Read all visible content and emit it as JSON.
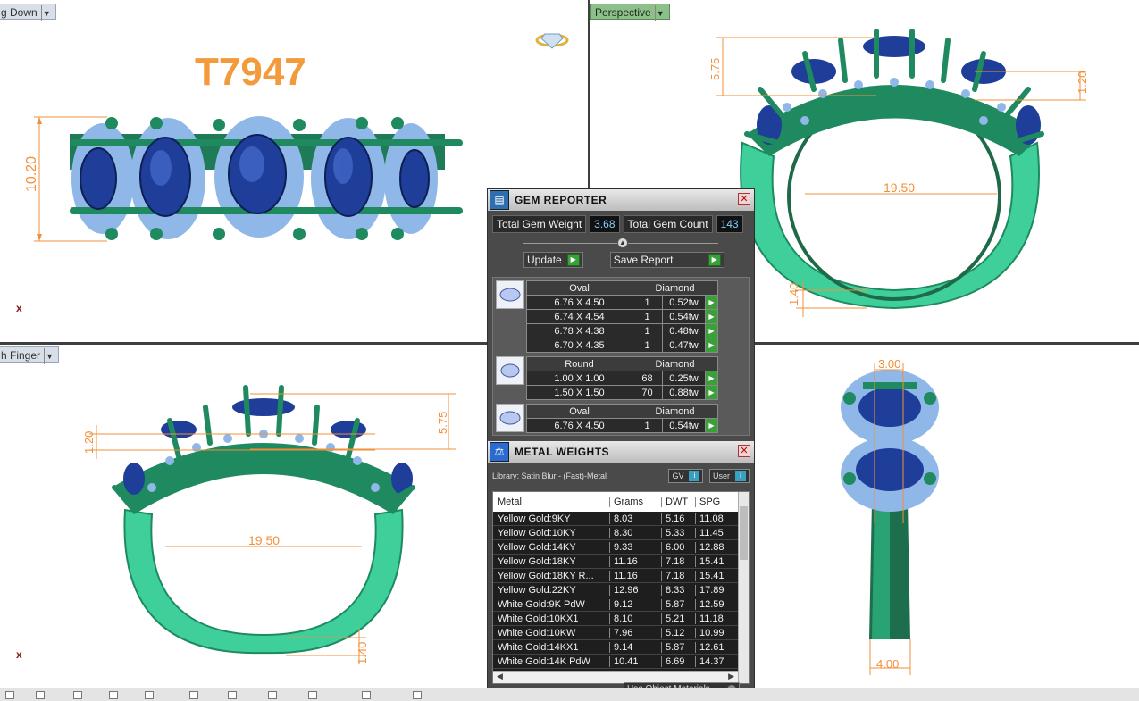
{
  "viewports": {
    "top_left": {
      "tab": "g Down",
      "title_code": "T7947",
      "dims": {
        "height": "10.20"
      }
    },
    "top_right": {
      "tab": "Perspective",
      "dims": {
        "top": "5.75",
        "right": "1.20",
        "width": "19.50",
        "bottom": "1.40"
      }
    },
    "bottom_left": {
      "tab": "h Finger",
      "dims": {
        "left": "1.20",
        "right": "5.75",
        "width": "19.50",
        "bottom": "1.40"
      }
    },
    "bottom_right": {
      "dims": {
        "top": "3.00",
        "bottom": "4.00"
      }
    }
  },
  "gem_reporter": {
    "title": "GEM REPORTER",
    "total_weight_label": "Total Gem Weight",
    "total_weight_value": "3.68",
    "total_count_label": "Total Gem Count",
    "total_count_value": "143",
    "update_label": "Update",
    "save_label": "Save Report",
    "groups": [
      {
        "shape": "Oval",
        "material": "Diamond",
        "rows": [
          {
            "size": "6.76 X 4.50",
            "qty": "1",
            "weight": "0.52tw"
          },
          {
            "size": "6.74 X 4.54",
            "qty": "1",
            "weight": "0.54tw"
          },
          {
            "size": "6.78 X 4.38",
            "qty": "1",
            "weight": "0.48tw"
          },
          {
            "size": "6.70 X 4.35",
            "qty": "1",
            "weight": "0.47tw"
          }
        ]
      },
      {
        "shape": "Round",
        "material": "Diamond",
        "rows": [
          {
            "size": "1.00 X 1.00",
            "qty": "68",
            "weight": "0.25tw"
          },
          {
            "size": "1.50 X 1.50",
            "qty": "70",
            "weight": "0.88tw"
          }
        ]
      },
      {
        "shape": "Oval",
        "material": "Diamond",
        "rows": [
          {
            "size": "6.76 X 4.50",
            "qty": "1",
            "weight": "0.54tw"
          }
        ]
      }
    ]
  },
  "metal_weights": {
    "title": "METAL WEIGHTS",
    "library": "Library: Satin Blur - (Fast)-Metal",
    "gv_label": "GV",
    "user_label": "User",
    "columns": [
      "Metal",
      "Grams",
      "DWT",
      "SPG"
    ],
    "rows": [
      [
        "Yellow Gold:9KY",
        "8.03",
        "5.16",
        "11.08"
      ],
      [
        "Yellow Gold:10KY",
        "8.30",
        "5.33",
        "11.45"
      ],
      [
        "Yellow Gold:14KY",
        "9.33",
        "6.00",
        "12.88"
      ],
      [
        "Yellow Gold:18KY",
        "11.16",
        "7.18",
        "15.41"
      ],
      [
        "Yellow Gold:18KY R...",
        "11.16",
        "7.18",
        "15.41"
      ],
      [
        "Yellow Gold:22KY",
        "12.96",
        "8.33",
        "17.89"
      ],
      [
        "White Gold:9K PdW",
        "9.12",
        "5.87",
        "12.59"
      ],
      [
        "White Gold:10KX1",
        "8.10",
        "5.21",
        "11.18"
      ],
      [
        "White Gold:10KW",
        "7.96",
        "5.12",
        "10.99"
      ],
      [
        "White Gold:14KX1",
        "9.14",
        "5.87",
        "12.61"
      ],
      [
        "White Gold:14K PdW",
        "10.41",
        "6.69",
        "14.37"
      ]
    ],
    "use_materials": "Use Object Materials"
  }
}
